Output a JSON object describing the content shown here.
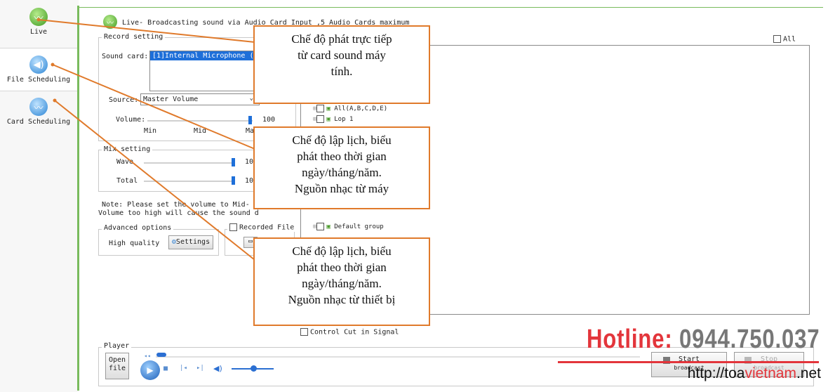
{
  "nav": {
    "items": [
      {
        "label": "Live",
        "icon": "live-icon"
      },
      {
        "label": "File Scheduling",
        "icon": "file-scheduling-icon"
      },
      {
        "label": "Card Scheduling",
        "icon": "card-scheduling-icon"
      }
    ]
  },
  "header": {
    "title": "Live- Broadcasting sound via Audio Card Input ,5 Audio Cards maximum"
  },
  "record": {
    "legend": "Record setting",
    "sound_card_label": "Sound card:",
    "sound_card_value": "[1]Internal Microphone (",
    "source_label": "Source:",
    "source_value": "Master Volume",
    "volume_label": "Volume:",
    "volume_value": "100",
    "scale_min": "Min",
    "scale_mid": "Mid",
    "scale_max": "Ma"
  },
  "mix": {
    "legend": "Mix setting",
    "wave_label": "Wave",
    "wave_value": "10",
    "total_label": "Total",
    "total_value": "10"
  },
  "note": {
    "line1": "Note: Please set the volume to Mid-",
    "line2": "Volume too high will cause the sound d"
  },
  "advanced": {
    "legend": "Advanced options",
    "high_quality_label": "High quality",
    "settings_button": "Settings",
    "recorded_file_label": "Recorded File"
  },
  "groups": {
    "all_label": "All",
    "tree": [
      "All(A,B,C,D,E)",
      "Lop 1",
      "Default group"
    ]
  },
  "control_cut_label": "Control Cut in Signal",
  "player": {
    "legend": "Player",
    "open_file_line1": "Open",
    "open_file_line2": "file"
  },
  "broadcast": {
    "start_label": "Start",
    "start_sub": "broadcast",
    "stop_label": "Stop",
    "stop_sub": "broadcast"
  },
  "callouts": [
    {
      "text1": "Chế độ phát trực tiếp",
      "text2": "từ card sound máy",
      "text3": "tính."
    },
    {
      "text1": "Chế độ lập lịch, biểu",
      "text2": "phát theo thời gian",
      "text3": "ngày/tháng/năm.",
      "text4": "Nguồn nhạc từ máy"
    },
    {
      "text1": "Chế độ lập lịch, biểu",
      "text2": "phát theo thời gian",
      "text3": "ngày/tháng/năm.",
      "text4": "Nguồn nhạc từ thiết bị"
    }
  ],
  "watermark": {
    "hotline_label": "Hotline:",
    "hotline_number": "0944.750.037",
    "url_prefix": "http://toa",
    "url_highlight": "vietnam",
    "url_suffix": ".net"
  },
  "colors": {
    "accent_green": "#79bb5d",
    "callout_border": "#e07a2b",
    "hotline_red": "#e3353b"
  }
}
